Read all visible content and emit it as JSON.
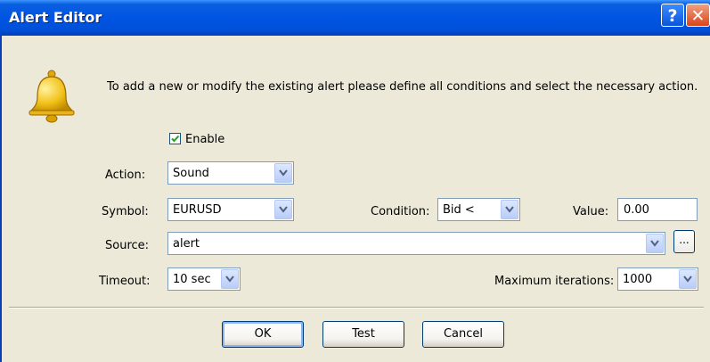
{
  "window": {
    "title": "Alert Editor",
    "help_glyph": "?",
    "close_glyph": "✕"
  },
  "intro_text": "To add a new or modify the existing alert please define all conditions and select the necessary action.",
  "enable": {
    "label": "Enable",
    "checked": true
  },
  "action": {
    "label": "Action:",
    "value": "Sound"
  },
  "symbol": {
    "label": "Symbol:",
    "value": "EURUSD"
  },
  "condition": {
    "label": "Condition:",
    "value": "Bid <"
  },
  "value_field": {
    "label": "Value:",
    "value": "0.00"
  },
  "source": {
    "label": "Source:",
    "value": "alert",
    "browse_label": "..."
  },
  "timeout": {
    "label": "Timeout:",
    "value": "10 sec"
  },
  "max_iterations": {
    "label": "Maximum iterations:",
    "value": "1000"
  },
  "buttons": {
    "ok": "OK",
    "test": "Test",
    "cancel": "Cancel"
  },
  "icons": {
    "bell": "bell-icon",
    "check": "checkmark-icon",
    "dropdown": "chevron-down-icon"
  },
  "colors": {
    "titlebar": "#0054E3",
    "dialog_bg": "#ECE9D8",
    "input_border": "#7F9DB9",
    "close": "#D9461C"
  }
}
